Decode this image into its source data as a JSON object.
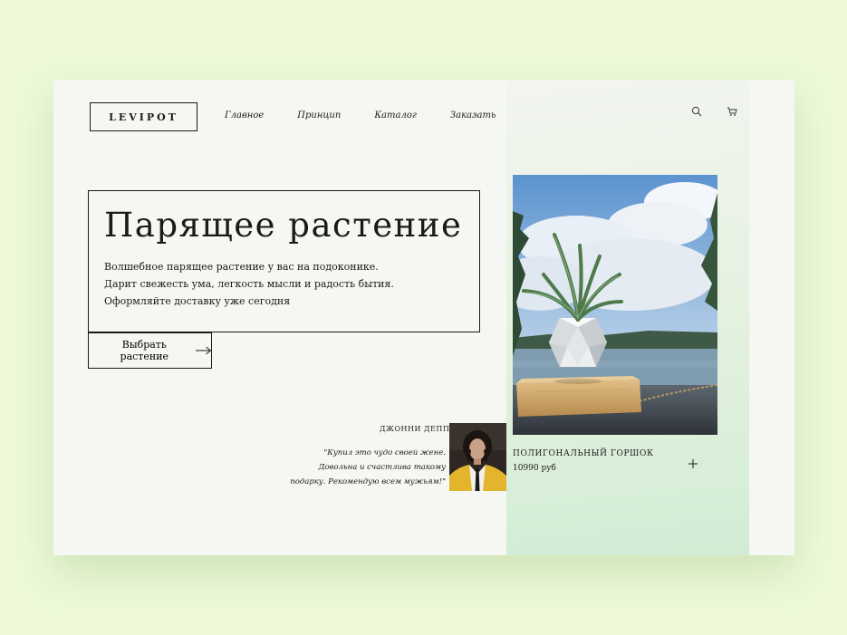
{
  "brand": {
    "logo": "LEVIPOT"
  },
  "nav": {
    "items": [
      "Главное",
      "Принцип",
      "Каталог",
      "Заказать"
    ]
  },
  "header_icons": [
    "search-icon",
    "cart-icon"
  ],
  "hero": {
    "title": "Парящее растение",
    "lines": [
      "Волшебное парящее растение у вас на подоконике.",
      "Дарит свежесть ума, легкость мысли и радость бытия.",
      "Оформляйте доставку уже сегодня"
    ],
    "cta_label": "Выбрать растение"
  },
  "review": {
    "author": "ДЖОННИ ДЕПП",
    "lines": [
      "\"Купил это чудо своей жене.",
      "Довольна и счастлива такому",
      "подарку. Рекомендую всем мужьям!\""
    ]
  },
  "product": {
    "name": "ПОЛИГОНАЛЬНЫЙ ГОРШОК",
    "price": "10990 руб"
  },
  "colors": {
    "page_background": "#edf9d9",
    "card_background": "#f5f7f3",
    "accent_green": "#d2ecd4",
    "text": "#1a1a1a"
  }
}
